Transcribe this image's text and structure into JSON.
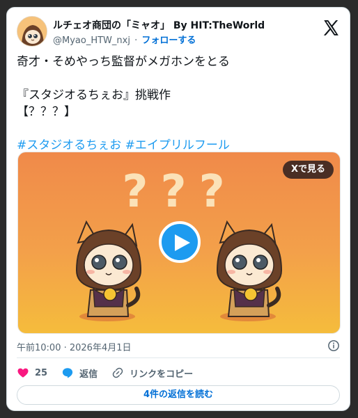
{
  "header": {
    "display_name": "ルチェオ商団の「ミャオ」 By HIT:TheWorld",
    "handle": "@Myao_HTW_nxj",
    "separator": "·",
    "follow_label": "フォローする"
  },
  "post": {
    "line1": "奇才・そめやっち監督がメガホンをとる",
    "line2": "『スタジオるちぇお』挑戦作",
    "line3": "【？？？】",
    "hashtags": [
      "#スタジオるちぇお",
      "#エイプリルフール"
    ]
  },
  "media": {
    "view_on_x_label": "Xで見る",
    "overlay_text": "???"
  },
  "meta": {
    "timestamp": "午前10:00 · 2026年4月1日"
  },
  "actions": {
    "like_count": "25",
    "reply_label": "返信",
    "copy_link_label": "リンクをコピー"
  },
  "read_replies_label": "4件の返信を読む",
  "colors": {
    "accent": "#1d9bf0",
    "link": "#006fd6",
    "like": "#f91880",
    "media_top": "#f08a4a",
    "media_bottom": "#f5bc3c"
  }
}
